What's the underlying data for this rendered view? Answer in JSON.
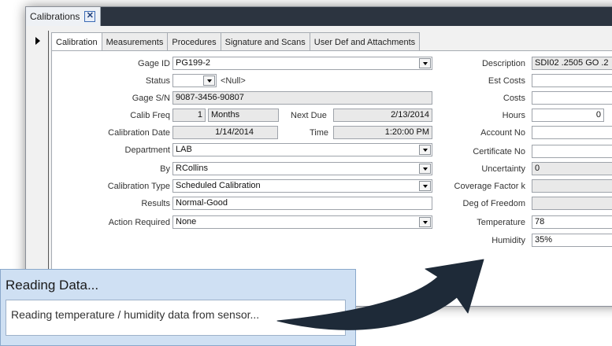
{
  "window": {
    "doc_tab_label": "Calibrations",
    "close_glyph": "✕"
  },
  "tabs": [
    {
      "label": "Calibration",
      "active": true
    },
    {
      "label": "Measurements",
      "active": false
    },
    {
      "label": "Procedures",
      "active": false
    },
    {
      "label": "Signature and Scans",
      "active": false
    },
    {
      "label": "User Def and Attachments",
      "active": false
    }
  ],
  "left": {
    "gage_id": {
      "label": "Gage ID",
      "value": "PG199-2"
    },
    "status": {
      "label": "Status",
      "value": "",
      "null_text": "<Null>"
    },
    "gage_sn": {
      "label": "Gage S/N",
      "value": "9087-3456-90807"
    },
    "calib_freq": {
      "label": "Calib Freq",
      "value": "1",
      "unit": "Months"
    },
    "next_due": {
      "label": "Next Due",
      "value": "2/13/2014"
    },
    "calibration_date": {
      "label": "Calibration Date",
      "value": "1/14/2014"
    },
    "time": {
      "label": "Time",
      "value": "1:20:00 PM"
    },
    "department": {
      "label": "Department",
      "value": "LAB"
    },
    "by": {
      "label": "By",
      "value": "RCollins"
    },
    "calibration_type": {
      "label": "Calibration Type",
      "value": "Scheduled Calibration"
    },
    "results": {
      "label": "Results",
      "value": "Normal-Good"
    },
    "action_required": {
      "label": "Action Required",
      "value": "None"
    }
  },
  "right": {
    "description": {
      "label": "Description",
      "value": "SDI02 .2505 GO .2"
    },
    "est_costs": {
      "label": "Est Costs",
      "value": ""
    },
    "costs": {
      "label": "Costs",
      "value": ""
    },
    "hours": {
      "label": "Hours",
      "value": "0"
    },
    "account_no": {
      "label": "Account No",
      "value": ""
    },
    "certificate_no": {
      "label": "Certificate No",
      "value": ""
    },
    "uncertainty": {
      "label": "Uncertainty",
      "value": "0"
    },
    "coverage_factor": {
      "label": "Coverage Factor k",
      "value": ""
    },
    "deg_of_freedom": {
      "label": "Deg of Freedom",
      "value": ""
    },
    "temperature": {
      "label": "Temperature",
      "value": "78"
    },
    "humidity": {
      "label": "Humidity",
      "value": "35%"
    }
  },
  "dialog": {
    "title": "Reading Data...",
    "message": "Reading temperature / humidity data from sensor..."
  },
  "colors": {
    "titlebar": "#2c3440",
    "dialog_bg": "#cfe0f3",
    "arrow": "#1e2a38"
  }
}
